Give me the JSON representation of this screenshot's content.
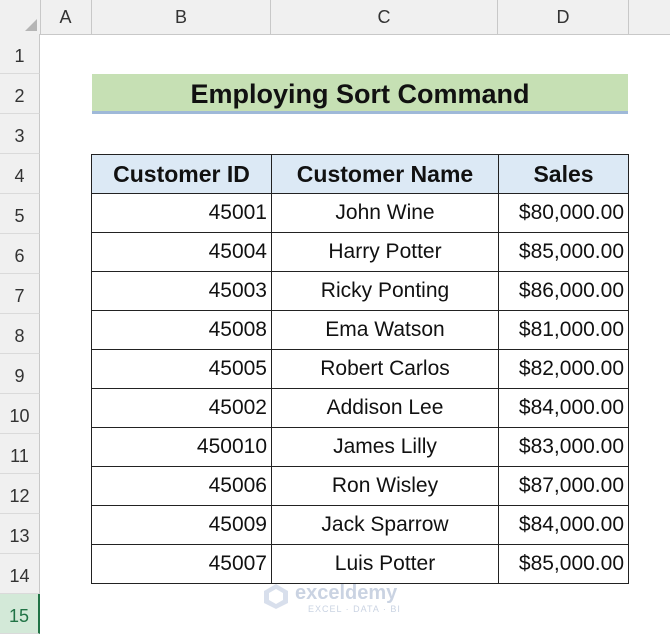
{
  "columns": [
    "A",
    "B",
    "C",
    "D"
  ],
  "rows": [
    "1",
    "2",
    "3",
    "4",
    "5",
    "6",
    "7",
    "8",
    "9",
    "10",
    "11",
    "12",
    "13",
    "14",
    "15"
  ],
  "title": "Employing Sort Command",
  "table": {
    "headers": [
      "Customer ID",
      "Customer Name",
      "Sales"
    ],
    "rows": [
      {
        "id": "45001",
        "name": "John Wine",
        "sales": "$80,000.00"
      },
      {
        "id": "45004",
        "name": "Harry Potter",
        "sales": "$85,000.00"
      },
      {
        "id": "45003",
        "name": "Ricky Ponting",
        "sales": "$86,000.00"
      },
      {
        "id": "45008",
        "name": "Ema Watson",
        "sales": "$81,000.00"
      },
      {
        "id": "45005",
        "name": "Robert Carlos",
        "sales": "$82,000.00"
      },
      {
        "id": "45002",
        "name": "Addison Lee",
        "sales": "$84,000.00"
      },
      {
        "id": "450010",
        "name": "James Lilly",
        "sales": "$83,000.00"
      },
      {
        "id": "45006",
        "name": "Ron Wisley",
        "sales": "$87,000.00"
      },
      {
        "id": "45009",
        "name": "Jack Sparrow",
        "sales": "$84,000.00"
      },
      {
        "id": "45007",
        "name": "Luis Potter",
        "sales": "$85,000.00"
      }
    ]
  },
  "watermark": {
    "name": "exceldemy",
    "tagline": "EXCEL · DATA · BI"
  },
  "colors": {
    "title_fill": "#c6e0b4",
    "header_fill": "#dce9f5",
    "active_row": "#217346"
  }
}
